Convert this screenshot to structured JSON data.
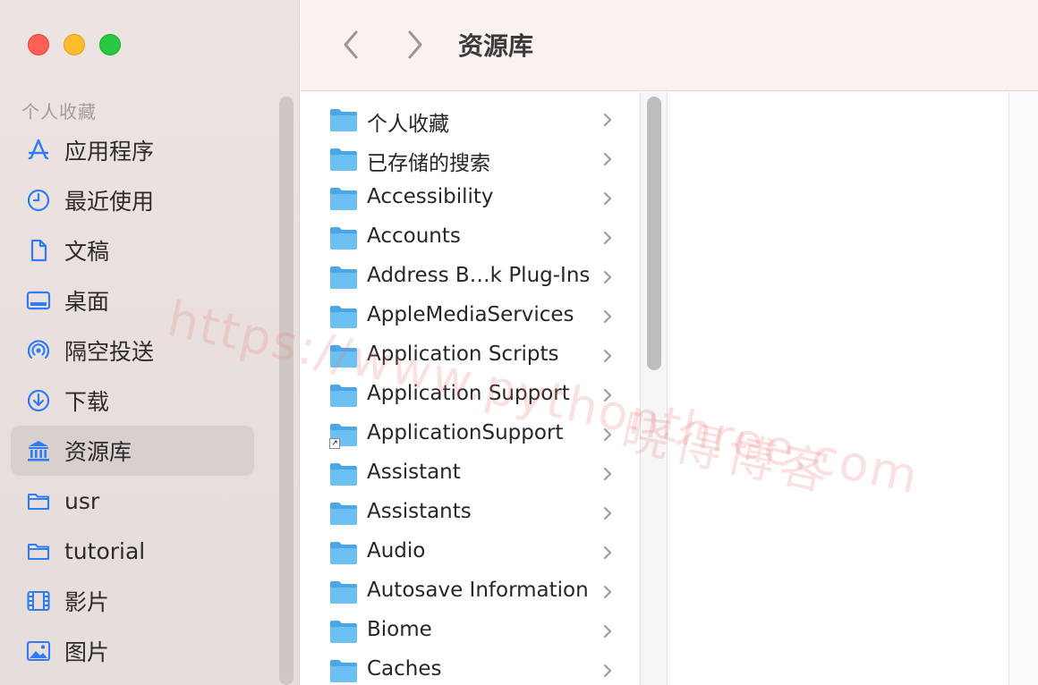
{
  "window": {
    "title": "资源库"
  },
  "sidebar": {
    "section_title": "个人收藏",
    "items": [
      {
        "label": "应用程序",
        "icon": "apps-icon"
      },
      {
        "label": "最近使用",
        "icon": "clock-icon"
      },
      {
        "label": "文稿",
        "icon": "document-icon"
      },
      {
        "label": "桌面",
        "icon": "desktop-icon"
      },
      {
        "label": "隔空投送",
        "icon": "airdrop-icon"
      },
      {
        "label": "下载",
        "icon": "download-icon"
      },
      {
        "label": "资源库",
        "icon": "library-icon",
        "active": true
      },
      {
        "label": "usr",
        "icon": "folder-icon"
      },
      {
        "label": "tutorial",
        "icon": "folder-icon"
      },
      {
        "label": "影片",
        "icon": "film-icon"
      },
      {
        "label": "图片",
        "icon": "photo-icon"
      }
    ]
  },
  "files": [
    {
      "name": "个人收藏"
    },
    {
      "name": "已存储的搜索"
    },
    {
      "name": "Accessibility"
    },
    {
      "name": "Accounts"
    },
    {
      "name": "Address B…k Plug-Ins"
    },
    {
      "name": "AppleMediaServices"
    },
    {
      "name": "Application Scripts"
    },
    {
      "name": "Application Support"
    },
    {
      "name": "ApplicationSupport",
      "alias": true
    },
    {
      "name": "Assistant"
    },
    {
      "name": "Assistants"
    },
    {
      "name": "Audio"
    },
    {
      "name": "Autosave Information"
    },
    {
      "name": "Biome"
    },
    {
      "name": "Caches"
    }
  ],
  "watermark": {
    "line1": "https://www.pythonthree.com",
    "line2": "晓得博客"
  },
  "colors": {
    "accent": "#2f7cf6",
    "folder": "#5fb7ee",
    "traffic_red": "#fe5f57",
    "traffic_yellow": "#febc2e",
    "traffic_green": "#28c840"
  }
}
